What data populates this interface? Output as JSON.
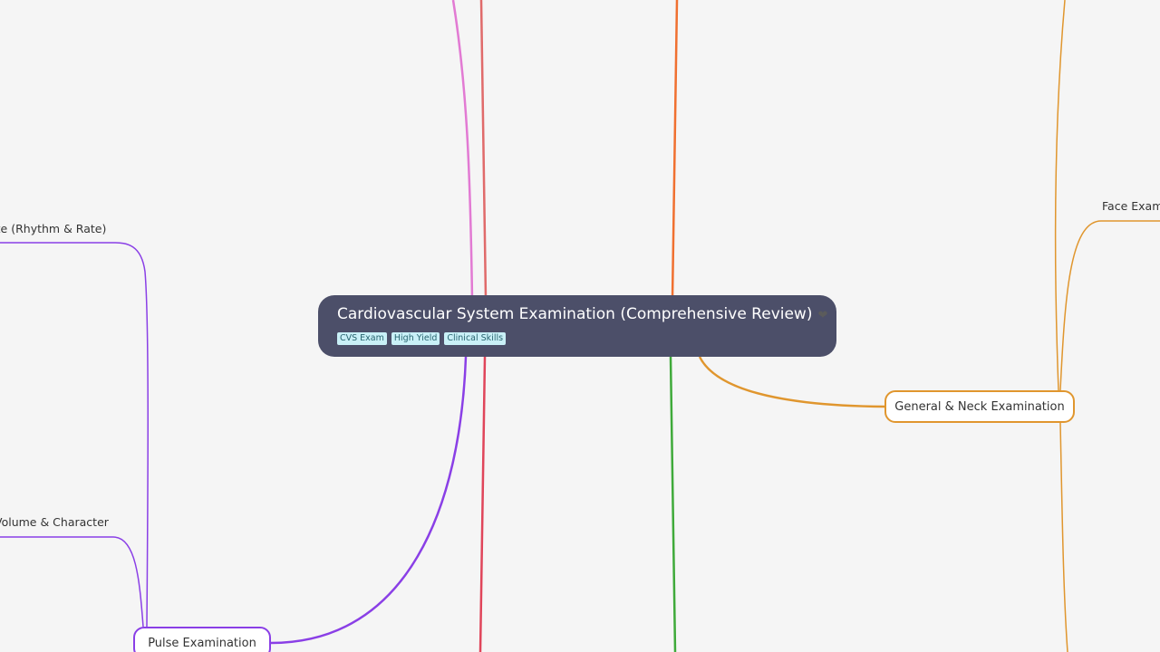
{
  "root": {
    "title": "Cardiovascular System Examination (Comprehensive Review)",
    "heart_icon": "heart-icon",
    "tags": [
      "CVS Exam",
      "High Yield",
      "Clinical Skills"
    ]
  },
  "branches": {
    "general_neck": "General & Neck Examination",
    "pulse": "Pulse Examination"
  },
  "leaves": {
    "rhythm_rate": "ate (Rhythm & Rate)",
    "volume_character": "Volume & Character",
    "face": "Face Exami"
  },
  "colors": {
    "background": "#f5f5f5",
    "root_fill": "#4c4f69",
    "tag_fill": "#c9f0f7",
    "pink": "#e27ad3",
    "salmon": "#e06a6a",
    "red": "#e0455a",
    "orange": "#f07030",
    "amber": "#e0962e",
    "green": "#3faa3a",
    "purple": "#8a3fe6"
  }
}
